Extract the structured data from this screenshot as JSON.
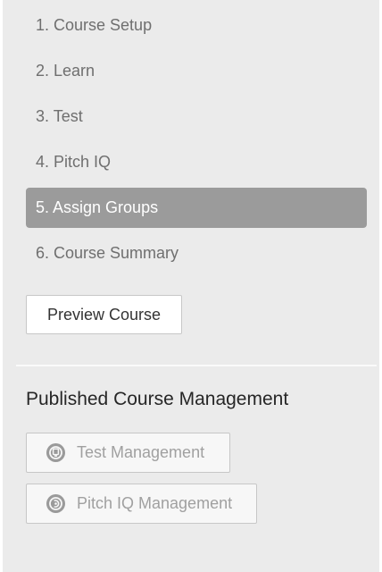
{
  "steps": [
    {
      "label": "1. Course Setup",
      "active": false
    },
    {
      "label": "2. Learn",
      "active": false
    },
    {
      "label": "3. Test",
      "active": false
    },
    {
      "label": "4. Pitch IQ",
      "active": false
    },
    {
      "label": "5. Assign Groups",
      "active": true
    },
    {
      "label": "6. Course Summary",
      "active": false
    }
  ],
  "preview_button": "Preview Course",
  "management": {
    "title": "Published Course Management",
    "test_button": {
      "label": "Test Management",
      "icon": "test-management-icon"
    },
    "pitch_button": {
      "label": "Pitch IQ Management",
      "icon": "pitch-iq-icon"
    }
  },
  "colors": {
    "panel_bg": "#ebebeb",
    "active_step_bg": "#9b9b9b",
    "step_text": "#6f6f6f",
    "disabled_text": "#a0a0a0"
  }
}
